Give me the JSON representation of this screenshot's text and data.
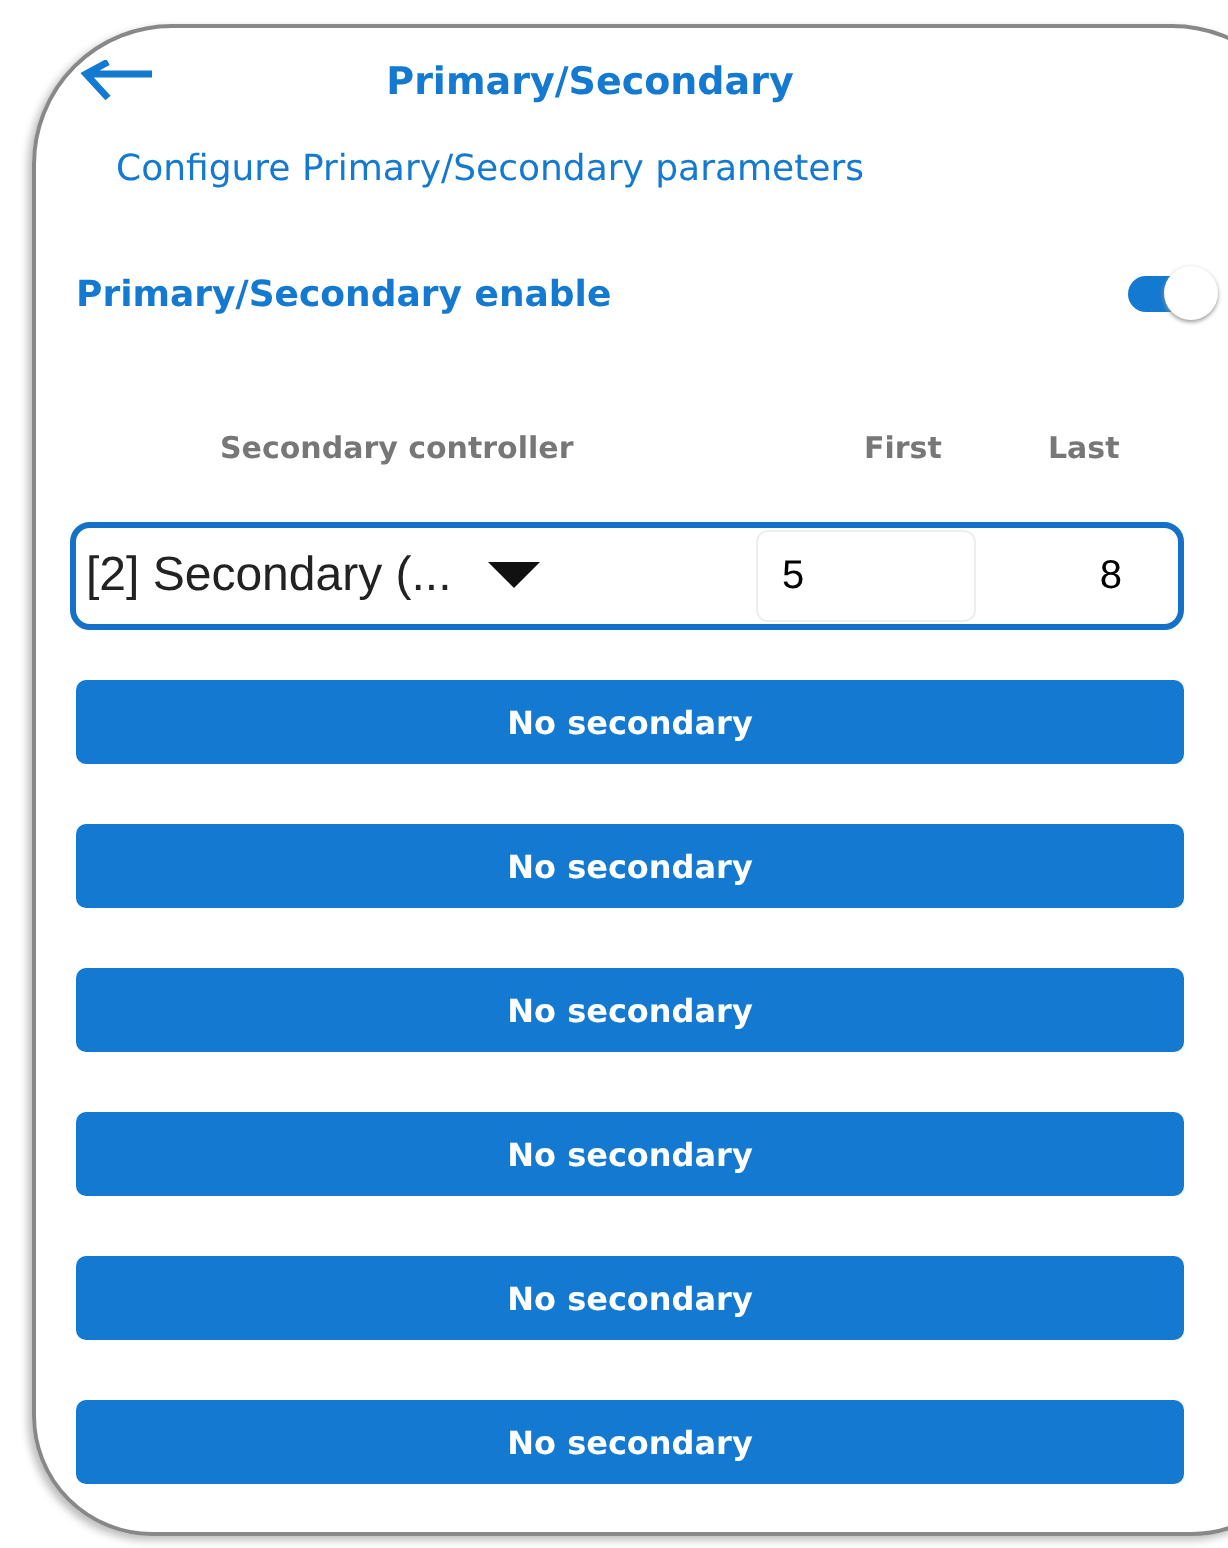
{
  "header": {
    "title": "Primary/Secondary",
    "subtitle": "Configure Primary/Secondary parameters"
  },
  "enable": {
    "label": "Primary/Secondary enable",
    "on": true
  },
  "columns": [
    "Secondary controller",
    "First",
    "Last"
  ],
  "rows": [
    {
      "controller": "[2] Secondary (...",
      "first": "5",
      "last": "8"
    }
  ],
  "buttons": [
    {
      "label": "No secondary"
    },
    {
      "label": "No secondary"
    },
    {
      "label": "No secondary"
    },
    {
      "label": "No secondary"
    },
    {
      "label": "No secondary"
    },
    {
      "label": "No secondary"
    }
  ]
}
